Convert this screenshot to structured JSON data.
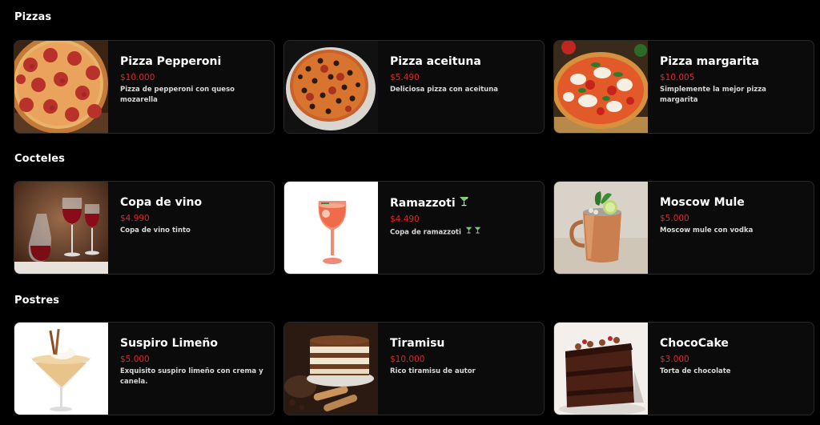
{
  "sections": [
    {
      "title": "Pizzas",
      "items": [
        {
          "name": "Pizza Pepperoni",
          "price": "$10.000",
          "description": "Pizza de pepperoni con queso mozarella",
          "image": "pepperoni-pizza-photo"
        },
        {
          "name": "Pizza aceituna",
          "price": "$5.490",
          "description": "Deliciosa pizza con aceituna",
          "image": "olive-pizza-photo"
        },
        {
          "name": "Pizza margarita",
          "price": "$10.005",
          "description": "Simplemente la mejor pizza margarita",
          "image": "margarita-pizza-photo"
        }
      ]
    },
    {
      "title": "Cocteles",
      "items": [
        {
          "name": "Copa de vino",
          "price": "$4.990",
          "description": "Copa de vino tinto",
          "image": "red-wine-photo"
        },
        {
          "name": "Ramazzoti",
          "price": "$4.490",
          "description": "Copa de ramazzoti",
          "image": "ramazzotti-spritz-photo",
          "title_icon": "cocktail-glass-icon",
          "desc_icons": [
            "cocktail-glass-icon",
            "cocktail-glass-icon"
          ]
        },
        {
          "name": "Moscow Mule",
          "price": "$5.000",
          "description": "Moscow mule con vodka",
          "image": "moscow-mule-photo"
        }
      ]
    },
    {
      "title": "Postres",
      "items": [
        {
          "name": "Suspiro Limeño",
          "price": "$5.000",
          "description": "Exquisito suspiro limeño con crema y canela.",
          "image": "suspiro-limeno-photo"
        },
        {
          "name": "Tiramisu",
          "price": "$10.000",
          "description": "Rico tiramisu de autor",
          "image": "tiramisu-photo"
        },
        {
          "name": "ChocoCake",
          "price": "$3.000",
          "description": "Torta de chocolate",
          "image": "chocolate-cake-photo"
        }
      ]
    }
  ],
  "colors": {
    "background": "#000000",
    "card_background": "#0b0b0b",
    "card_border": "#2a2a2a",
    "price": "#e0262a",
    "title": "#ffffff"
  }
}
